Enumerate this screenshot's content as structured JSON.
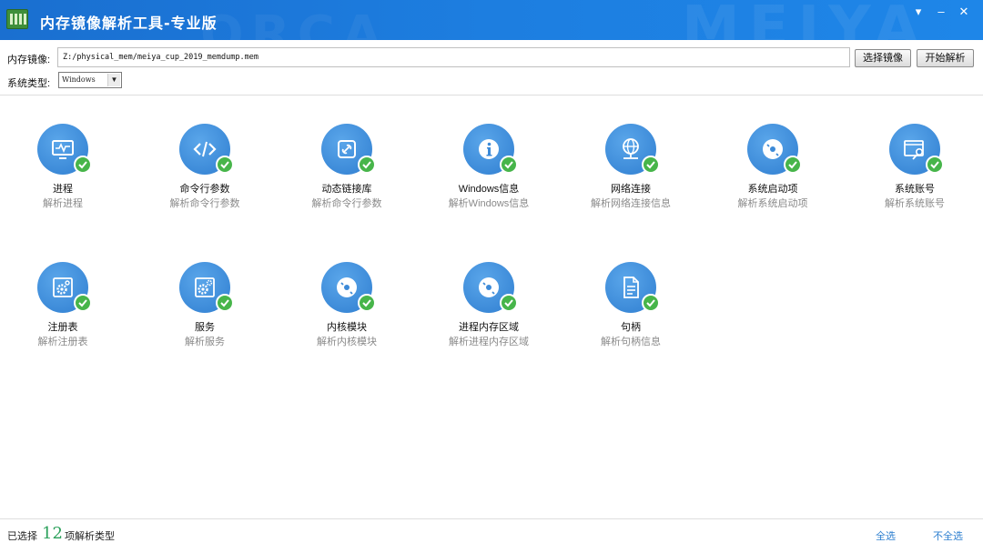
{
  "window": {
    "title": "内存镜像解析工具-专业版",
    "controls": [
      "▾",
      "–",
      "✕"
    ]
  },
  "toolbar": {
    "image_label": "内存镜像:",
    "image_path": "Z:/physical_mem/meiya_cup_2019_memdump.mem",
    "select_image_button": "选择镜像",
    "start_parse_button": "开始解析",
    "os_label": "系统类型:",
    "os_selected": "Windows"
  },
  "items": [
    {
      "title": "进程",
      "subtitle": "解析进程",
      "icon": "monitor-icon",
      "checked": true
    },
    {
      "title": "命令行参数",
      "subtitle": "解析命令行参数",
      "icon": "code-icon",
      "checked": true
    },
    {
      "title": "动态链接库",
      "subtitle": "解析命令行参数",
      "icon": "link-icon",
      "checked": true
    },
    {
      "title": "Windows信息",
      "subtitle": "解析Windows信息",
      "icon": "info-icon",
      "checked": true
    },
    {
      "title": "网络连接",
      "subtitle": "解析网络连接信息",
      "icon": "globe-icon",
      "checked": true
    },
    {
      "title": "系统启动项",
      "subtitle": "解析系统启动项",
      "icon": "disc-icon",
      "checked": true
    },
    {
      "title": "系统账号",
      "subtitle": "解析系统账号",
      "icon": "key-window-icon",
      "checked": true
    },
    {
      "title": "注册表",
      "subtitle": "解析注册表",
      "icon": "registry-gear-icon",
      "checked": true
    },
    {
      "title": "服务",
      "subtitle": "解析服务",
      "icon": "service-gear-icon",
      "checked": true
    },
    {
      "title": "内核模块",
      "subtitle": "解析内核模块",
      "icon": "disc-icon",
      "checked": true
    },
    {
      "title": "进程内存区域",
      "subtitle": "解析进程内存区域",
      "icon": "disc-icon",
      "checked": true
    },
    {
      "title": "句柄",
      "subtitle": "解析句柄信息",
      "icon": "document-icon",
      "checked": true
    }
  ],
  "footer": {
    "selected_prefix": "已选择",
    "selected_count": "12",
    "selected_suffix": "项解析类型",
    "select_all": "全选",
    "select_none": "不全选"
  },
  "colors": {
    "titlebar": "#1d7ee0",
    "icon_circle": "#3c8ad8",
    "check": "#47b54a",
    "link": "#2d7fd0",
    "count": "#2aa05a"
  }
}
